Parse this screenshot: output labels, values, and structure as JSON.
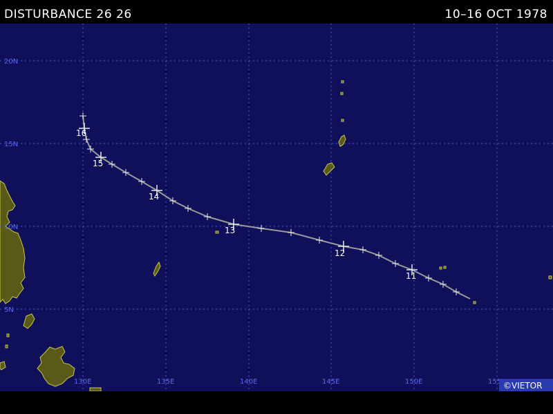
{
  "header": {
    "title": "DISTURBANCE 26 26",
    "dates": "10–16 OCT 1978"
  },
  "map": {
    "colors": {
      "ocean": "#10105a",
      "land": "#5a5a18",
      "coast": "#c8c850",
      "grid": "#4a58d6",
      "grid_label": "#5a6aee",
      "track": "#9a9a9a",
      "marker": "#e8e8e8"
    },
    "lon_labels": [
      "130E",
      "135E",
      "140E",
      "145E",
      "150E",
      "155E"
    ],
    "lat_labels": [
      "20N",
      "15N",
      "10N",
      "5N"
    ],
    "credit": "©VIETOR",
    "day_labels": [
      "16",
      "15",
      "14",
      "13",
      "12",
      "11"
    ]
  }
}
